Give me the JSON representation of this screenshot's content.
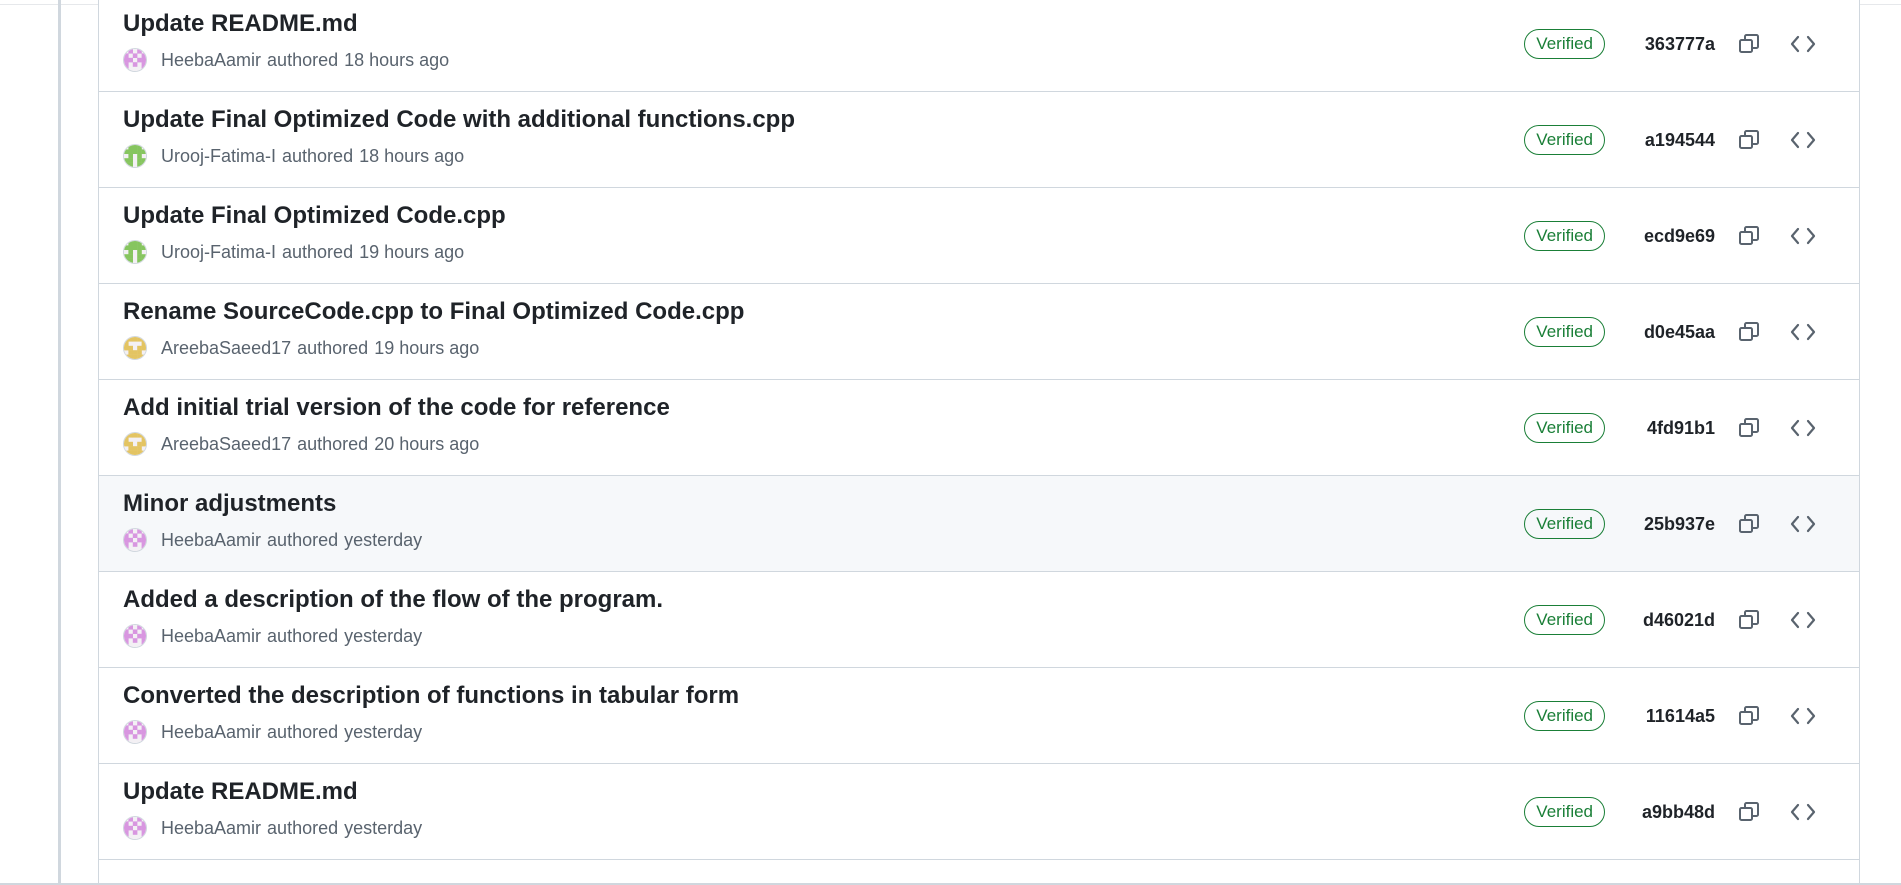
{
  "commits": [
    {
      "title": "Update README.md",
      "author": "HeebaAamir",
      "authored": "authored",
      "time": "18 hours ago",
      "verified": "Verified",
      "sha": "363777a",
      "avatar": "heeba"
    },
    {
      "title": "Update Final Optimized Code with additional functions.cpp",
      "author": "Urooj-Fatima-I",
      "authored": "authored",
      "time": "18 hours ago",
      "verified": "Verified",
      "sha": "a194544",
      "avatar": "urooj"
    },
    {
      "title": "Update Final Optimized Code.cpp",
      "author": "Urooj-Fatima-I",
      "authored": "authored",
      "time": "19 hours ago",
      "verified": "Verified",
      "sha": "ecd9e69",
      "avatar": "urooj"
    },
    {
      "title": "Rename SourceCode.cpp to Final Optimized Code.cpp",
      "author": "AreebaSaeed17",
      "authored": "authored",
      "time": "19 hours ago",
      "verified": "Verified",
      "sha": "d0e45aa",
      "avatar": "areeba"
    },
    {
      "title": "Add initial trial version of the code for reference",
      "author": "AreebaSaeed17",
      "authored": "authored",
      "time": "20 hours ago",
      "verified": "Verified",
      "sha": "4fd91b1",
      "avatar": "areeba"
    },
    {
      "title": "Minor adjustments",
      "author": "HeebaAamir",
      "authored": "authored",
      "time": "yesterday",
      "verified": "Verified",
      "sha": "25b937e",
      "avatar": "heeba"
    },
    {
      "title": "Added a description of the flow of the program.",
      "author": "HeebaAamir",
      "authored": "authored",
      "time": "yesterday",
      "verified": "Verified",
      "sha": "d46021d",
      "avatar": "heeba"
    },
    {
      "title": "Converted the description of functions in tabular form",
      "author": "HeebaAamir",
      "authored": "authored",
      "time": "yesterday",
      "verified": "Verified",
      "sha": "11614a5",
      "avatar": "heeba"
    },
    {
      "title": "Update README.md",
      "author": "HeebaAamir",
      "authored": "authored",
      "time": "yesterday",
      "verified": "Verified",
      "sha": "a9bb48d",
      "avatar": "heeba"
    }
  ],
  "hovered_row": 5,
  "colors": {
    "verified_green": "#1a7f37",
    "row_hover": "#f6f8fa",
    "border": "#d0d7de",
    "muted_text": "#59636e",
    "avatar_heeba": "#d896e0",
    "avatar_urooj": "#86c55f",
    "avatar_areeba": "#e3c463"
  },
  "icons": {
    "copy": "copy-icon",
    "browse": "code-icon"
  }
}
